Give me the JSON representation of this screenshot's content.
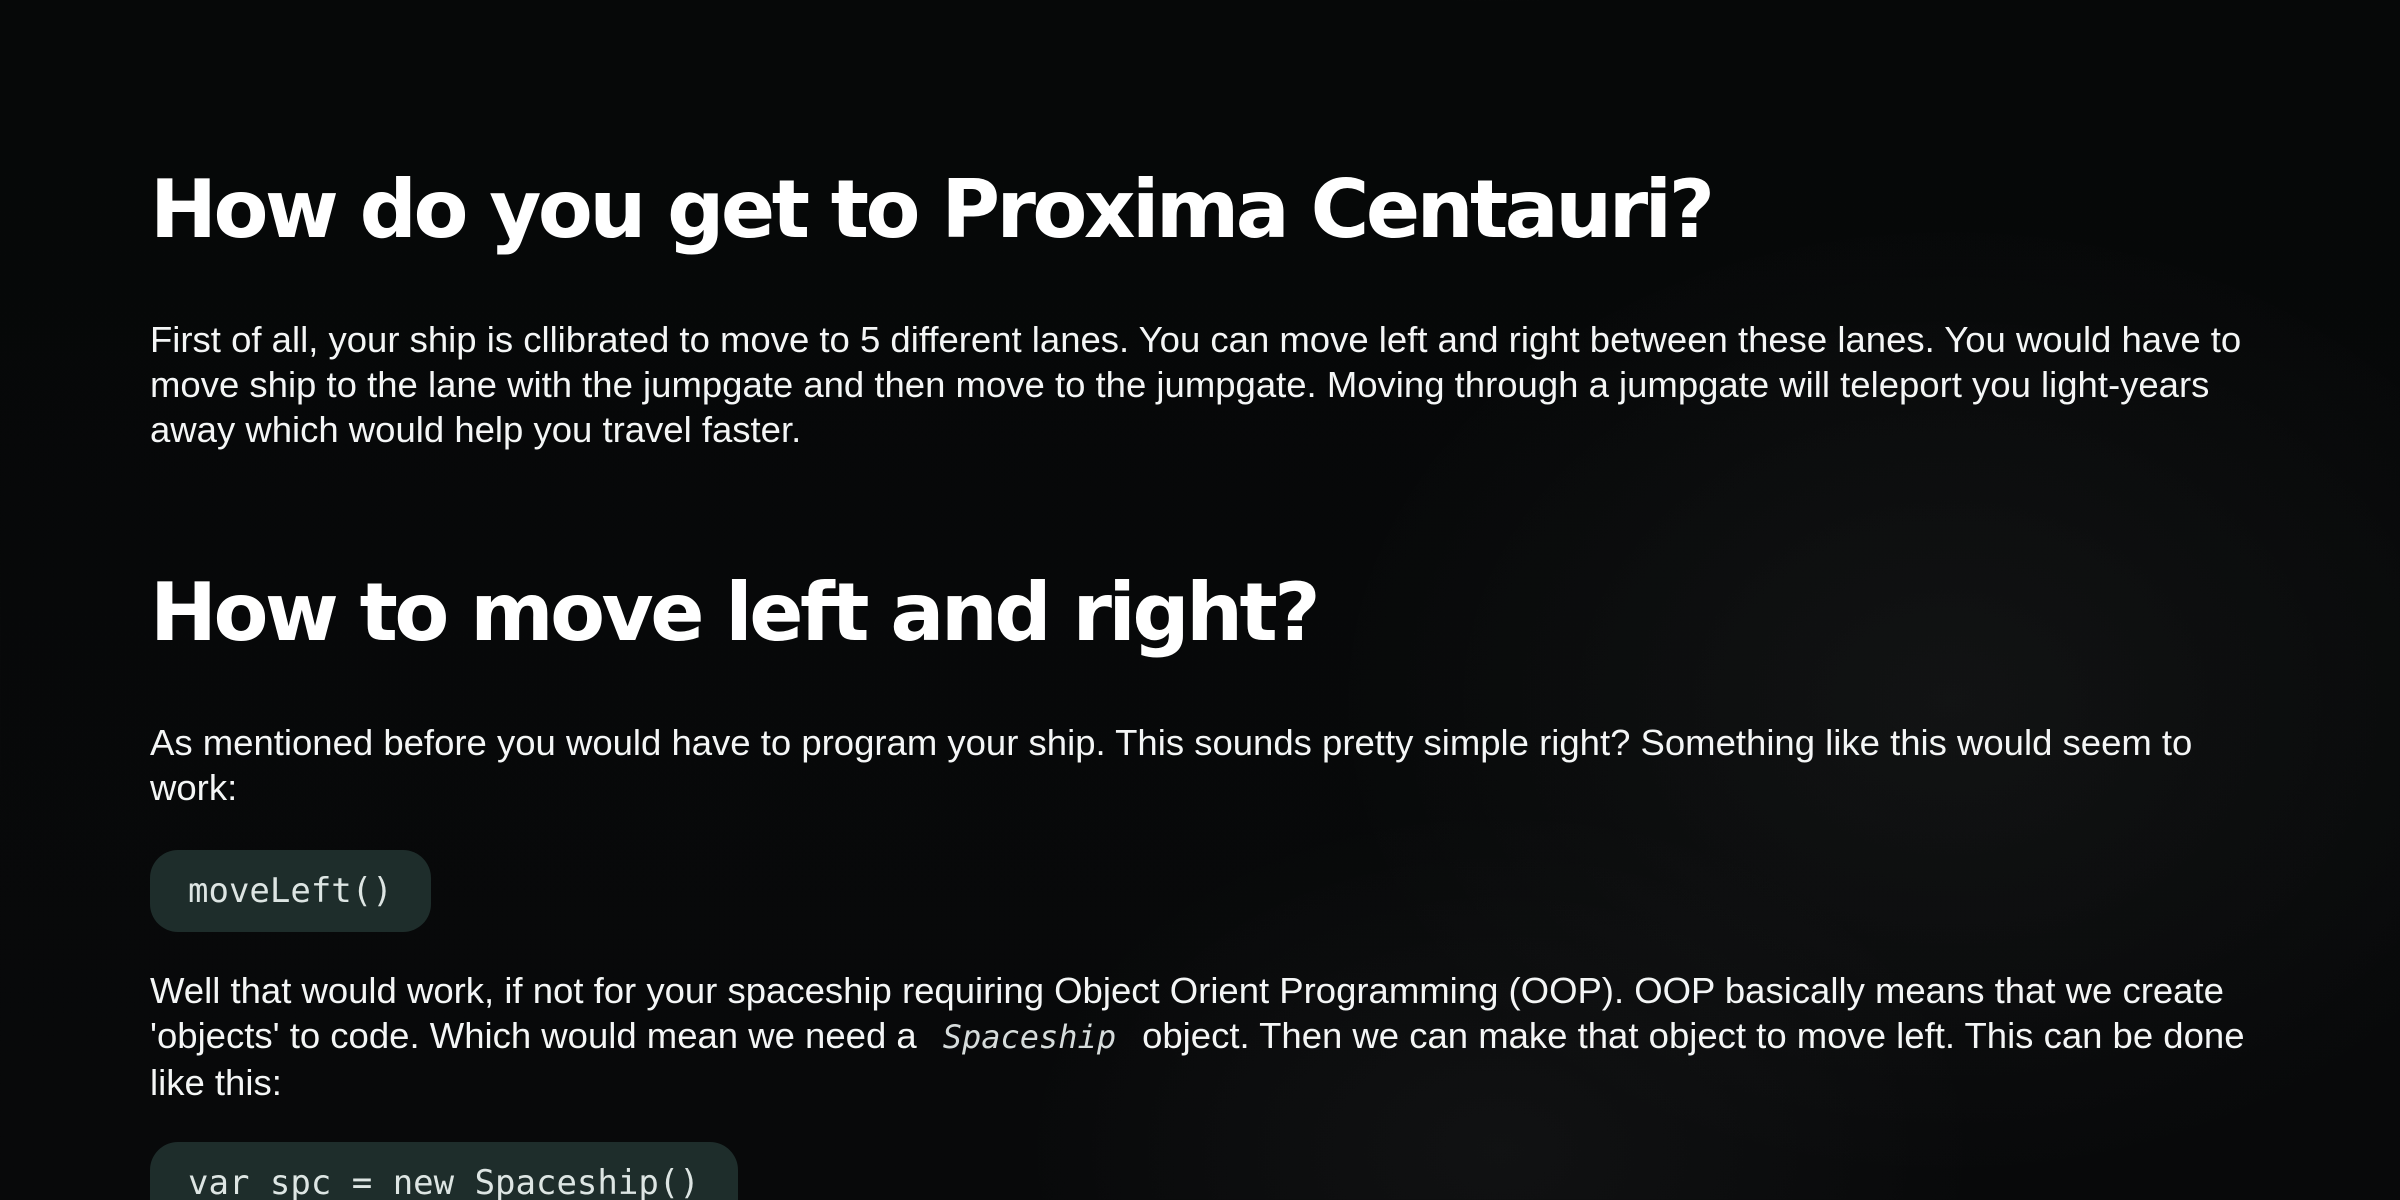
{
  "sections": [
    {
      "heading": "How do you get to Proxima Centauri?",
      "paragraph": "First of all, your ship is cllibrated to move to 5 different lanes. You can move left and right between these lanes. You would have to move ship to the lane with the jumpgate and then move to the jumpgate. Moving through a jumpgate will teleport you light-years away which would help you travel faster."
    },
    {
      "heading": "How to move left and right?",
      "paragraph": "As mentioned before you would have to program your ship. This sounds pretty simple right? Something like this would seem to work:",
      "code_1": "moveLeft()",
      "oop_before": "Well that would work, if not for your spaceship requiring Object Orient Programming (OOP). OOP basically means that we create 'objects' to code. Which would mean we need a",
      "oop_inline_code": "Spaceship",
      "oop_after": "object. Then we can make that object to move left. This can be done like this:",
      "code_2": "var spc = new Spaceship()"
    }
  ]
}
